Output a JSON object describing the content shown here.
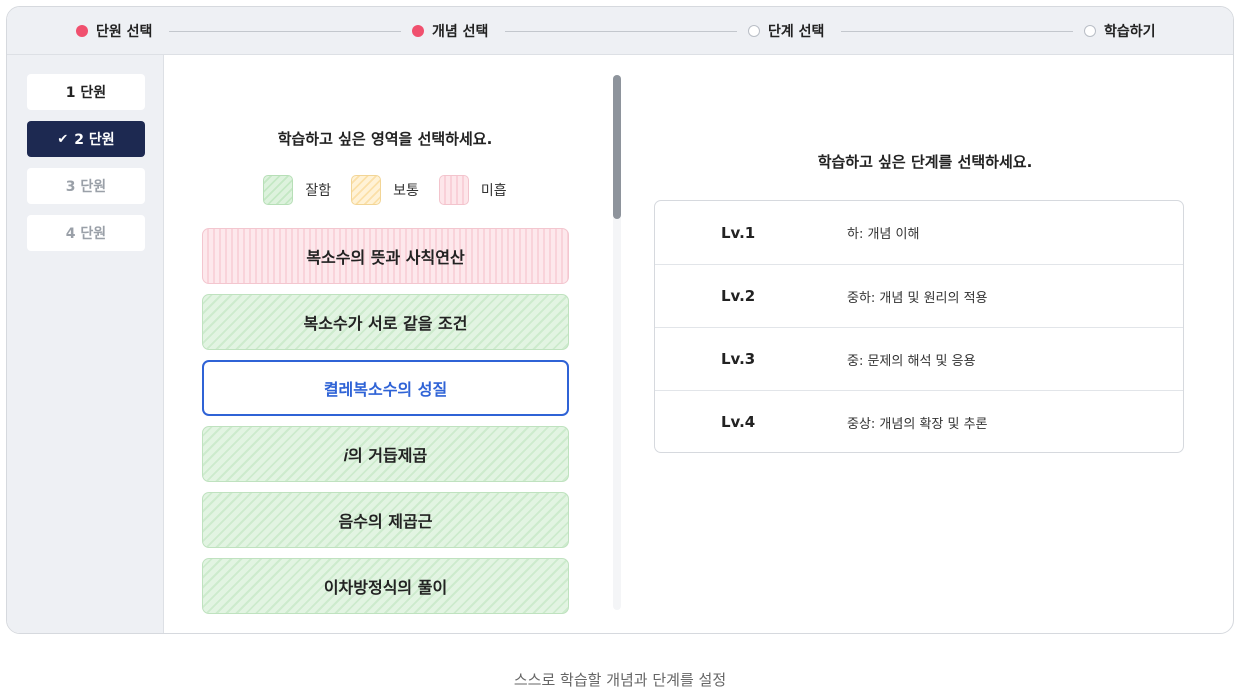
{
  "stepper": {
    "steps": [
      {
        "label": "단원 선택",
        "status": "done"
      },
      {
        "label": "개념 선택",
        "status": "current"
      },
      {
        "label": "단계 선택",
        "status": "pending"
      },
      {
        "label": "학습하기",
        "status": "pending"
      }
    ],
    "active_color": "#f0506e"
  },
  "sidebar": {
    "units": [
      {
        "label": "1 단원",
        "state": "available"
      },
      {
        "label": "2 단원",
        "state": "selected",
        "check": "✔"
      },
      {
        "label": "3 단원",
        "state": "disabled"
      },
      {
        "label": "4 단원",
        "state": "disabled"
      }
    ],
    "selected_color": "#1d2951"
  },
  "concept_panel": {
    "title": "학습하고 싶은 영역을 선택하세요.",
    "legend": [
      {
        "label": "잘함",
        "key": "good"
      },
      {
        "label": "보통",
        "key": "normal"
      },
      {
        "label": "미흡",
        "key": "poor"
      }
    ],
    "topics": [
      {
        "label": "복소수의 뜻과 사칙연산",
        "status": "poor"
      },
      {
        "label": "복소수가 서로 같을 조건",
        "status": "good"
      },
      {
        "label": "켤레복소수의 성질",
        "status": "active"
      },
      {
        "label": "𝑖의 거듭제곱",
        "status": "good"
      },
      {
        "label": "음수의 제곱근",
        "status": "good"
      },
      {
        "label": "이차방정식의 풀이",
        "status": "good"
      }
    ],
    "active_color": "#2f63d6"
  },
  "level_panel": {
    "title": "학습하고 싶은 단계를 선택하세요.",
    "levels": [
      {
        "code": "Lv.1",
        "desc": "하: 개념 이해"
      },
      {
        "code": "Lv.2",
        "desc": "중하: 개념 및 원리의 적용"
      },
      {
        "code": "Lv.3",
        "desc": "중: 문제의 해석 및 응용"
      },
      {
        "code": "Lv.4",
        "desc": "중상: 개념의 확장 및 추론"
      }
    ]
  },
  "caption": "스스로 학습할 개념과 단계를 설정"
}
